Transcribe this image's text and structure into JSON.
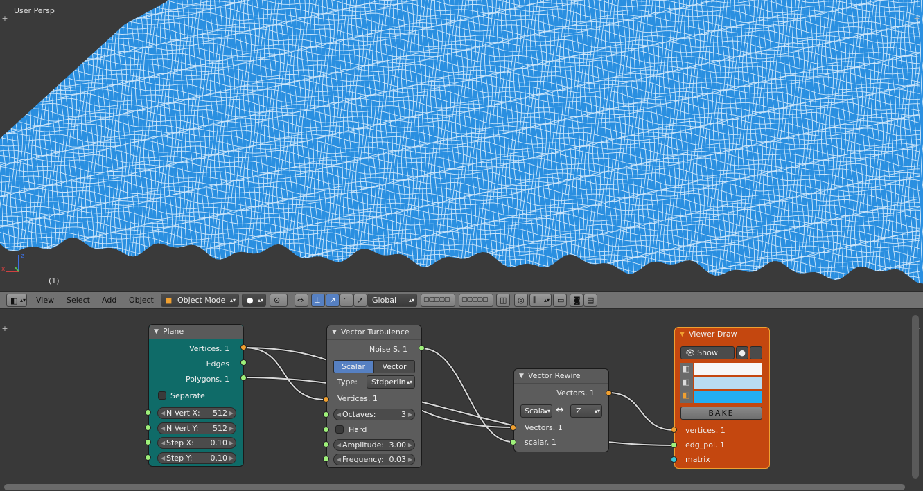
{
  "viewport": {
    "title": "User Persp",
    "frame": "(1)",
    "axis_x": "x",
    "axis_z": "z",
    "mesh_color": "#2a8fe0"
  },
  "header": {
    "menus": [
      "View",
      "Select",
      "Add",
      "Object"
    ],
    "mode": "Object Mode",
    "orientation": "Global"
  },
  "nodes": {
    "plane": {
      "title": "Plane",
      "color": "#0f6b68",
      "outputs": [
        "Vertices. 1",
        "Edges",
        "Polygons. 1"
      ],
      "separate_label": "Separate",
      "fields": [
        {
          "label": "N Vert X:",
          "value": "512"
        },
        {
          "label": "N Vert Y:",
          "value": "512"
        },
        {
          "label": "Step X:",
          "value": "0.10"
        },
        {
          "label": "Step Y:",
          "value": "0.10"
        }
      ]
    },
    "turbulence": {
      "title": "Vector Turbulence",
      "color": "#5c5c5c",
      "output": "Noise S. 1",
      "modes": [
        "Scalar",
        "Vector"
      ],
      "active_mode": "Scalar",
      "type_label": "Type:",
      "type_value": "Stdperlin",
      "input_vertices": "Vertices. 1",
      "octaves": {
        "label": "Octaves:",
        "value": "3"
      },
      "hard_label": "Hard",
      "amplitude": {
        "label": "Amplitude:",
        "value": "3.00"
      },
      "frequency": {
        "label": "Frequency:",
        "value": "0.03"
      }
    },
    "rewire": {
      "title": "Vector Rewire",
      "color": "#5c5c5c",
      "output": "Vectors. 1",
      "from": "Scala",
      "swap": "↔",
      "to": "Z",
      "inputs": [
        "Vectors. 1",
        "scalar. 1"
      ]
    },
    "viewer": {
      "title": "Viewer Draw",
      "color": "#c4470f",
      "show_label": "Show",
      "bake_label": "BAKE",
      "swatches": [
        "#f7f7f7",
        "#b9dcf2",
        "#24aef2"
      ],
      "inputs": [
        "vertices. 1",
        "edg_pol. 1",
        "matrix"
      ]
    }
  }
}
